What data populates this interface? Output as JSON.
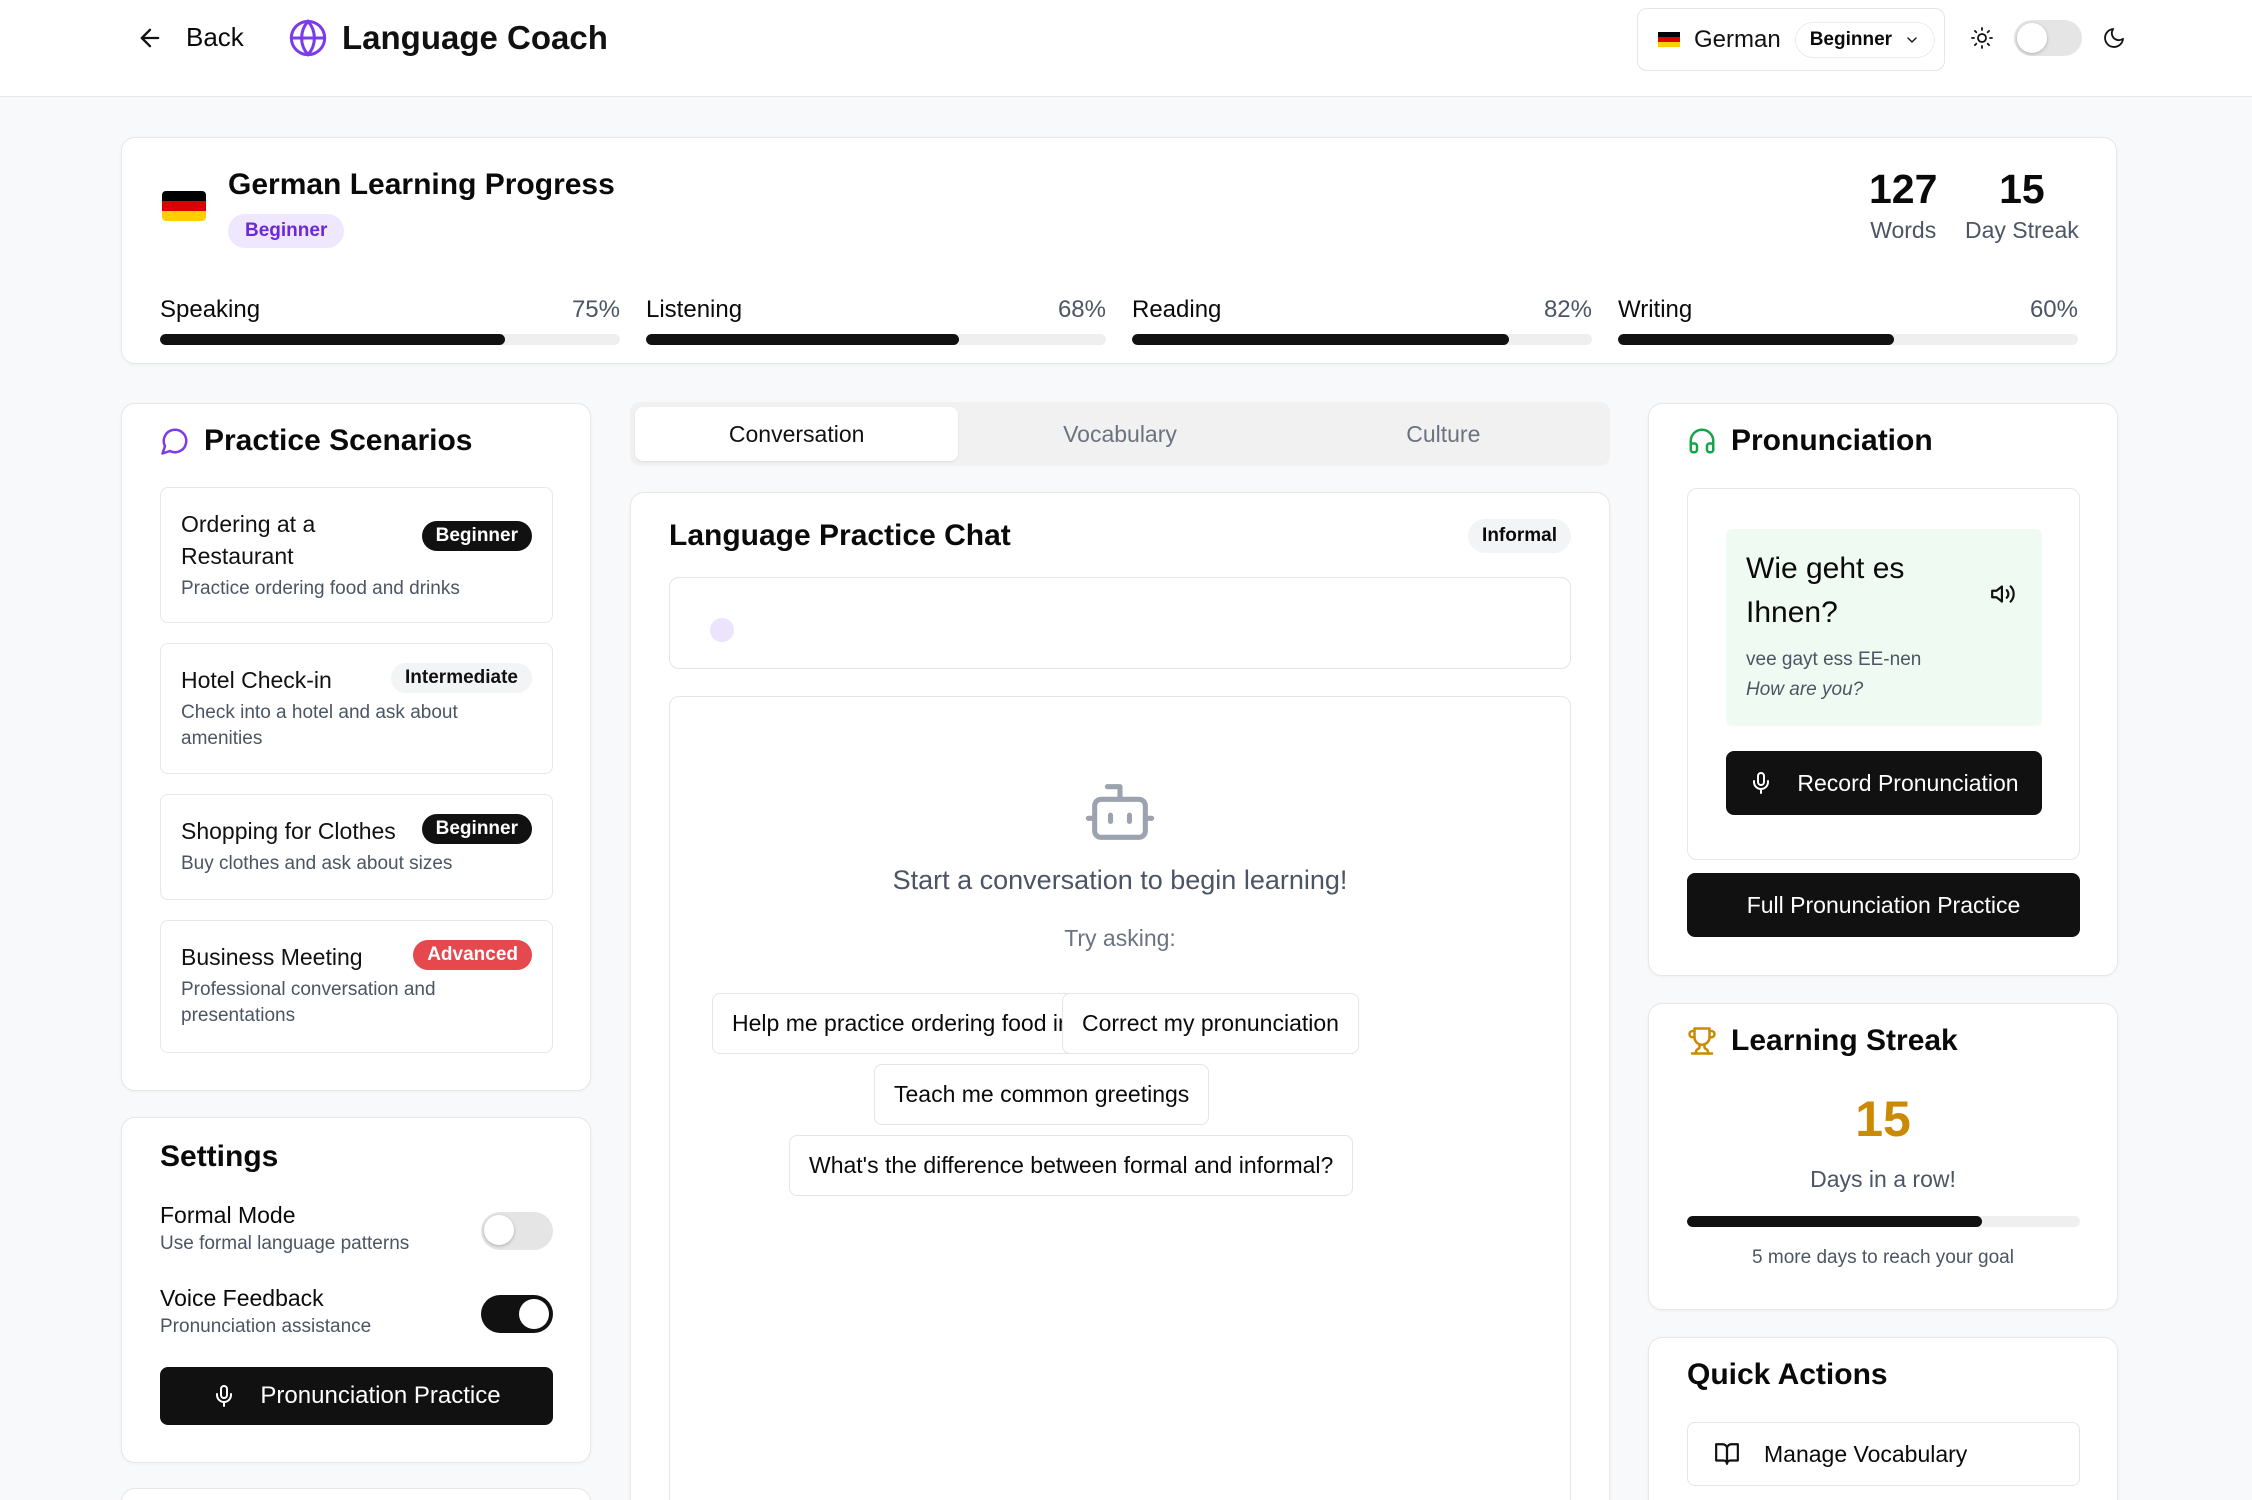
{
  "header": {
    "back_label": "Back",
    "app_title": "Language Coach",
    "language": "German",
    "level": "Beginner"
  },
  "progress": {
    "title": "German Learning Progress",
    "level_badge": "Beginner",
    "stats": [
      {
        "value": "127",
        "label": "Words"
      },
      {
        "value": "15",
        "label": "Day Streak"
      }
    ],
    "skills": [
      {
        "name": "Speaking",
        "percent_label": "75%",
        "value": 0.75
      },
      {
        "name": "Listening",
        "percent_label": "68%",
        "value": 0.68
      },
      {
        "name": "Reading",
        "percent_label": "82%",
        "value": 0.82
      },
      {
        "name": "Writing",
        "percent_label": "60%",
        "value": 0.6
      }
    ]
  },
  "scenarios": {
    "title": "Practice Scenarios",
    "items": [
      {
        "title": "Ordering at a Restaurant",
        "desc": "Practice ordering food and drinks",
        "level": "Beginner"
      },
      {
        "title": "Hotel Check-in",
        "desc": "Check into a hotel and ask about amenities",
        "level": "Intermediate"
      },
      {
        "title": "Shopping for Clothes",
        "desc": "Buy clothes and ask about sizes",
        "level": "Beginner"
      },
      {
        "title": "Business Meeting",
        "desc": "Professional conversation and presentations",
        "level": "Advanced"
      }
    ]
  },
  "settings": {
    "title": "Settings",
    "formal_label": "Formal Mode",
    "formal_desc": "Use formal language patterns",
    "formal_on": false,
    "voice_label": "Voice Feedback",
    "voice_desc": "Pronunciation assistance",
    "voice_on": true,
    "practice_button": "Pronunciation Practice"
  },
  "tabs": [
    {
      "label": "Conversation",
      "active": true
    },
    {
      "label": "Vocabulary",
      "active": false
    },
    {
      "label": "Culture",
      "active": false
    }
  ],
  "chat": {
    "title": "Language Practice Chat",
    "formality_badge": "Informal",
    "empty_title": "Start a conversation to begin learning!",
    "try_label": "Try asking:",
    "suggestions": [
      "Help me practice ordering food in Spanish",
      "Correct my pronunciation",
      "Teach me common greetings",
      "What's the difference between formal and informal?"
    ]
  },
  "pronunciation": {
    "title": "Pronunciation",
    "phrase": "Wie geht es Ihnen?",
    "phonetic": "vee gayt ess EE-nen",
    "translation": "How are you?",
    "record_button": "Record Pronunciation",
    "full_button": "Full Pronunciation Practice"
  },
  "streak": {
    "title": "Learning Streak",
    "days": "15",
    "label": "Days in a row!",
    "progress": 0.75,
    "goal_text": "5 more days to reach your goal"
  },
  "quick_actions": {
    "title": "Quick Actions",
    "items": [
      "Manage Vocabulary"
    ]
  },
  "colors": {
    "accent_purple": "#6d28d9",
    "advanced_red": "#e5484d",
    "streak_gold": "#ca8a04",
    "pronunciation_green": "#16a34a",
    "flag": [
      "#000000",
      "#dd0000",
      "#ffce00"
    ]
  }
}
